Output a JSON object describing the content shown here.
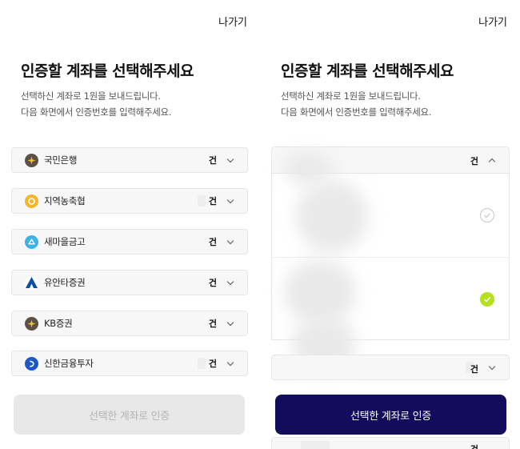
{
  "left": {
    "exit_label": "나가기",
    "title": "인증할 계좌를 선택해주세요",
    "subtitle_line1": "선택하신 계좌로 1원을 보내드립니다.",
    "subtitle_line2": "다음 화면에서 인증번호를 입력해주세요.",
    "institutions": [
      {
        "name": "국민은행",
        "count_suffix": "건",
        "logo_icon": "kb-star-icon",
        "logo_color": "#5d5146"
      },
      {
        "name": "지역농축협",
        "count_suffix": "건",
        "logo_icon": "nh-coin-icon",
        "logo_color": "#f5b72a"
      },
      {
        "name": "새마을금고",
        "count_suffix": "건",
        "logo_icon": "mg-cloud-icon",
        "logo_color": "#3fb2e6"
      },
      {
        "name": "유안타증권",
        "count_suffix": "건",
        "logo_icon": "yuanta-a-icon",
        "logo_color": "#0b4ea2"
      },
      {
        "name": "KB증권",
        "count_suffix": "건",
        "logo_icon": "kb-star-icon",
        "logo_color": "#5d5146"
      },
      {
        "name": "신한금융투자",
        "count_suffix": "건",
        "logo_icon": "shinhan-icon",
        "logo_color": "#1d59c2"
      }
    ],
    "submit_label": "선택한 계좌로 인증",
    "submit_enabled": false
  },
  "right": {
    "exit_label": "나가기",
    "title": "인증할 계좌를 선택해주세요",
    "subtitle_line1": "선택하신 계좌로 1원을 보내드립니다.",
    "subtitle_line2": "다음 화면에서 인증번호를 입력해주세요.",
    "expanded_count_suffix": "건",
    "accounts": [
      {
        "selected": false
      },
      {
        "selected": true
      }
    ],
    "next_count_suffix": "건",
    "last_count_suffix": "건",
    "submit_label": "선택한 계좌로 인증",
    "submit_enabled": true
  },
  "colors": {
    "primary_button": "#130c5c",
    "disabled_button": "#e8e8e8",
    "check_selected": "#b4e01e"
  }
}
